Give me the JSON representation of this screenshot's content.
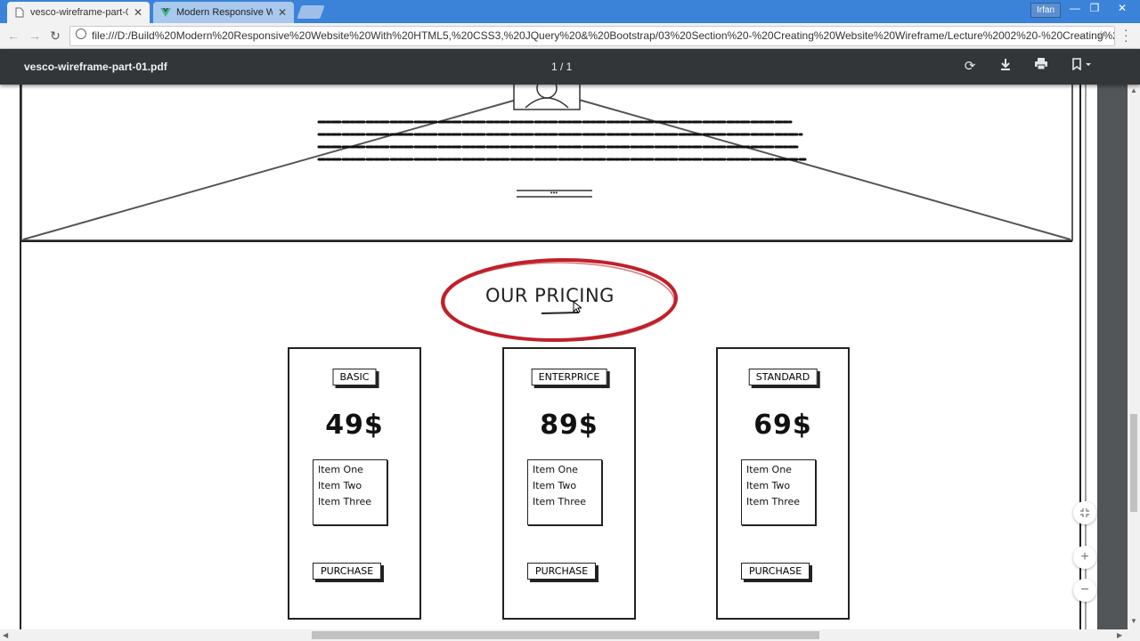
{
  "browser": {
    "tabs": [
      {
        "title": "vesco-wireframe-part-01.",
        "active": true
      },
      {
        "title": "Modern Responsive Web",
        "active": false
      }
    ],
    "user": "Irfan",
    "url": "file:///D:/Build%20Modern%20Responsive%20Website%20With%20HTML5,%20CSS3,%20JQuery%20&%20Bootstrap/03%20Section%20-%20Creating%20Website%20Wireframe/Lecture%2002%20-%20Creating%20W"
  },
  "pdf": {
    "filename": "vesco-wireframe-part-01.pdf",
    "page_indicator": "1 / 1"
  },
  "wireframe": {
    "section_title": "OUR PRICING",
    "highlight_color": "#c0202a",
    "plans": [
      {
        "name": "BASIC",
        "price": "49$",
        "items": [
          "Item One",
          "Item Two",
          "Item Three"
        ],
        "button": "PURCHASE"
      },
      {
        "name": "ENTERPRICE",
        "price": "89$",
        "items": [
          "Item One",
          "Item Two",
          "Item Three"
        ],
        "button": "PURCHASE"
      },
      {
        "name": "STANDARD",
        "price": "69$",
        "items": [
          "Item One",
          "Item Two",
          "Item Three"
        ],
        "button": "PURCHASE"
      }
    ]
  },
  "zoom_controls": [
    "fit-icon",
    "zoom-in-icon",
    "zoom-out-icon"
  ]
}
